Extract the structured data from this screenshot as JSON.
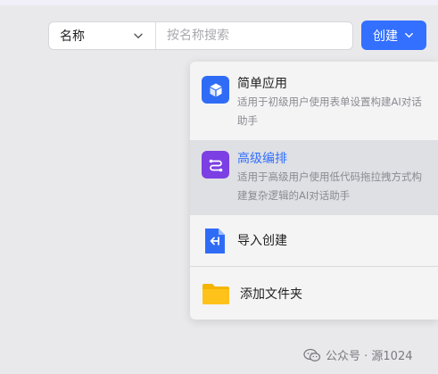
{
  "search": {
    "select_value": "名称",
    "placeholder": "按名称搜索"
  },
  "create_button": {
    "label": "创建"
  },
  "menu": {
    "items": [
      {
        "title": "简单应用",
        "description": "适用于初级用户使用表单设置构建AI对话助手",
        "icon": "cube-icon",
        "icon_color": "#2f6cf6"
      },
      {
        "title": "高级编排",
        "description": "适用于高级用户使用低代码拖拉拽方式构建复杂逻辑的AI对话助手",
        "icon": "workflow-icon",
        "icon_color": "#7b3fe4",
        "title_color": "#3370ff",
        "hovered": true
      },
      {
        "title": "导入创建",
        "icon": "import-file-icon",
        "icon_color": "#2f6cf6"
      },
      {
        "title": "添加文件夹",
        "icon": "folder-icon",
        "icon_color": "#f5b400"
      }
    ]
  },
  "watermark": {
    "text": "公众号 · 源1024"
  }
}
